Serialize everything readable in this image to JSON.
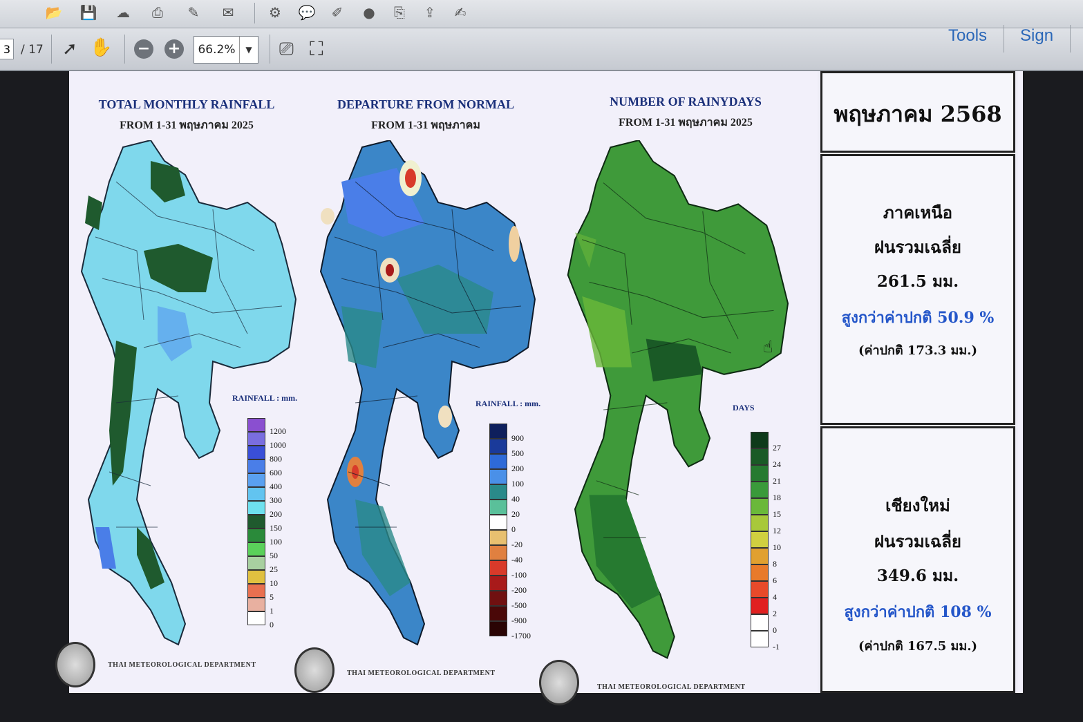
{
  "toolbar": {
    "page_current": "3",
    "page_total": "/ 17",
    "zoom": "66.2%",
    "tools_label": "Tools",
    "sign_label": "Sign"
  },
  "maps": [
    {
      "title": "TOTAL MONTHLY RAINFALL",
      "subtitle": "FROM 1-31 พฤษภาคม 2025",
      "legend_title": "RAINFALL : mm.",
      "legend": [
        {
          "label": "1200",
          "color": "#8a4fd0"
        },
        {
          "label": "1000",
          "color": "#7a6ee0"
        },
        {
          "label": "800",
          "color": "#3a4fd8"
        },
        {
          "label": "600",
          "color": "#4a7ee8"
        },
        {
          "label": "400",
          "color": "#5aa0f0"
        },
        {
          "label": "300",
          "color": "#62c4f0"
        },
        {
          "label": "200",
          "color": "#6ee0ee"
        },
        {
          "label": "150",
          "color": "#1f5a2e"
        },
        {
          "label": "100",
          "color": "#2a8a3a"
        },
        {
          "label": "50",
          "color": "#5ad05a"
        },
        {
          "label": "25",
          "color": "#a8d0a0"
        },
        {
          "label": "10",
          "color": "#e0c040"
        },
        {
          "label": "5",
          "color": "#e87050"
        },
        {
          "label": "1",
          "color": "#e8b0a0"
        },
        {
          "label": "0",
          "color": "#ffffff"
        }
      ],
      "dept": "THAI METEOROLOGICAL DEPARTMENT"
    },
    {
      "title": "DEPARTURE FROM NORMAL",
      "subtitle": "FROM 1-31 พฤษภาคม",
      "legend_title": "RAINFALL : mm.",
      "legend": [
        {
          "label": "900",
          "color": "#0e1f5c"
        },
        {
          "label": "500",
          "color": "#1a3a9a"
        },
        {
          "label": "200",
          "color": "#2e6ad8"
        },
        {
          "label": "100",
          "color": "#4a90e8"
        },
        {
          "label": "40",
          "color": "#2a8a8a"
        },
        {
          "label": "20",
          "color": "#5ac09a"
        },
        {
          "label": "0",
          "color": "#ffffff"
        },
        {
          "label": "-20",
          "color": "#e8c070"
        },
        {
          "label": "-40",
          "color": "#e08040"
        },
        {
          "label": "-100",
          "color": "#d83a2a"
        },
        {
          "label": "-200",
          "color": "#a81a1a"
        },
        {
          "label": "-500",
          "color": "#701010"
        },
        {
          "label": "-900",
          "color": "#4a0808"
        },
        {
          "label": "-1700",
          "color": "#2a0404"
        }
      ],
      "dept": "THAI METEOROLOGICAL DEPARTMENT"
    },
    {
      "title": "NUMBER OF RAINYDAYS",
      "subtitle": "FROM 1-31 พฤษภาคม 2025",
      "legend_title": "DAYS",
      "legend": [
        {
          "label": "27",
          "color": "#0e3a1a"
        },
        {
          "label": "24",
          "color": "#1a5a26"
        },
        {
          "label": "21",
          "color": "#267a30"
        },
        {
          "label": "18",
          "color": "#3a9a3a"
        },
        {
          "label": "15",
          "color": "#6ab83a"
        },
        {
          "label": "12",
          "color": "#a8c83a"
        },
        {
          "label": "10",
          "color": "#d0d040"
        },
        {
          "label": "8",
          "color": "#e0a030"
        },
        {
          "label": "6",
          "color": "#e87a2a"
        },
        {
          "label": "4",
          "color": "#e84a2a"
        },
        {
          "label": "2",
          "color": "#e02020"
        },
        {
          "label": "0",
          "color": "#ffffff"
        },
        {
          "label": "-1",
          "color": "#ffffff"
        }
      ],
      "dept": "THAI METEOROLOGICAL DEPARTMENT"
    }
  ],
  "panel": {
    "month": "พฤษภาคม 2568",
    "region": {
      "name": "ภาคเหนือ",
      "avg_label": "ฝนรวมเฉลี่ย",
      "value": "261.5 มม.",
      "compare": "สูงกว่าค่าปกติ 50.9 %",
      "normal": "(ค่าปกติ 173.3 มม.)"
    },
    "province": {
      "name": "เชียงใหม่",
      "avg_label": "ฝนรวมเฉลี่ย",
      "value": "349.6 มม.",
      "compare": "สูงกว่าค่าปกติ 108 %",
      "normal": "(ค่าปกติ 167.5 มม.)"
    }
  },
  "colors": {
    "map1_base": "#7fd8ec",
    "map2_base": "#3b86c8",
    "map3_base": "#3f9a3a",
    "accent_blue": "#2456c9"
  }
}
